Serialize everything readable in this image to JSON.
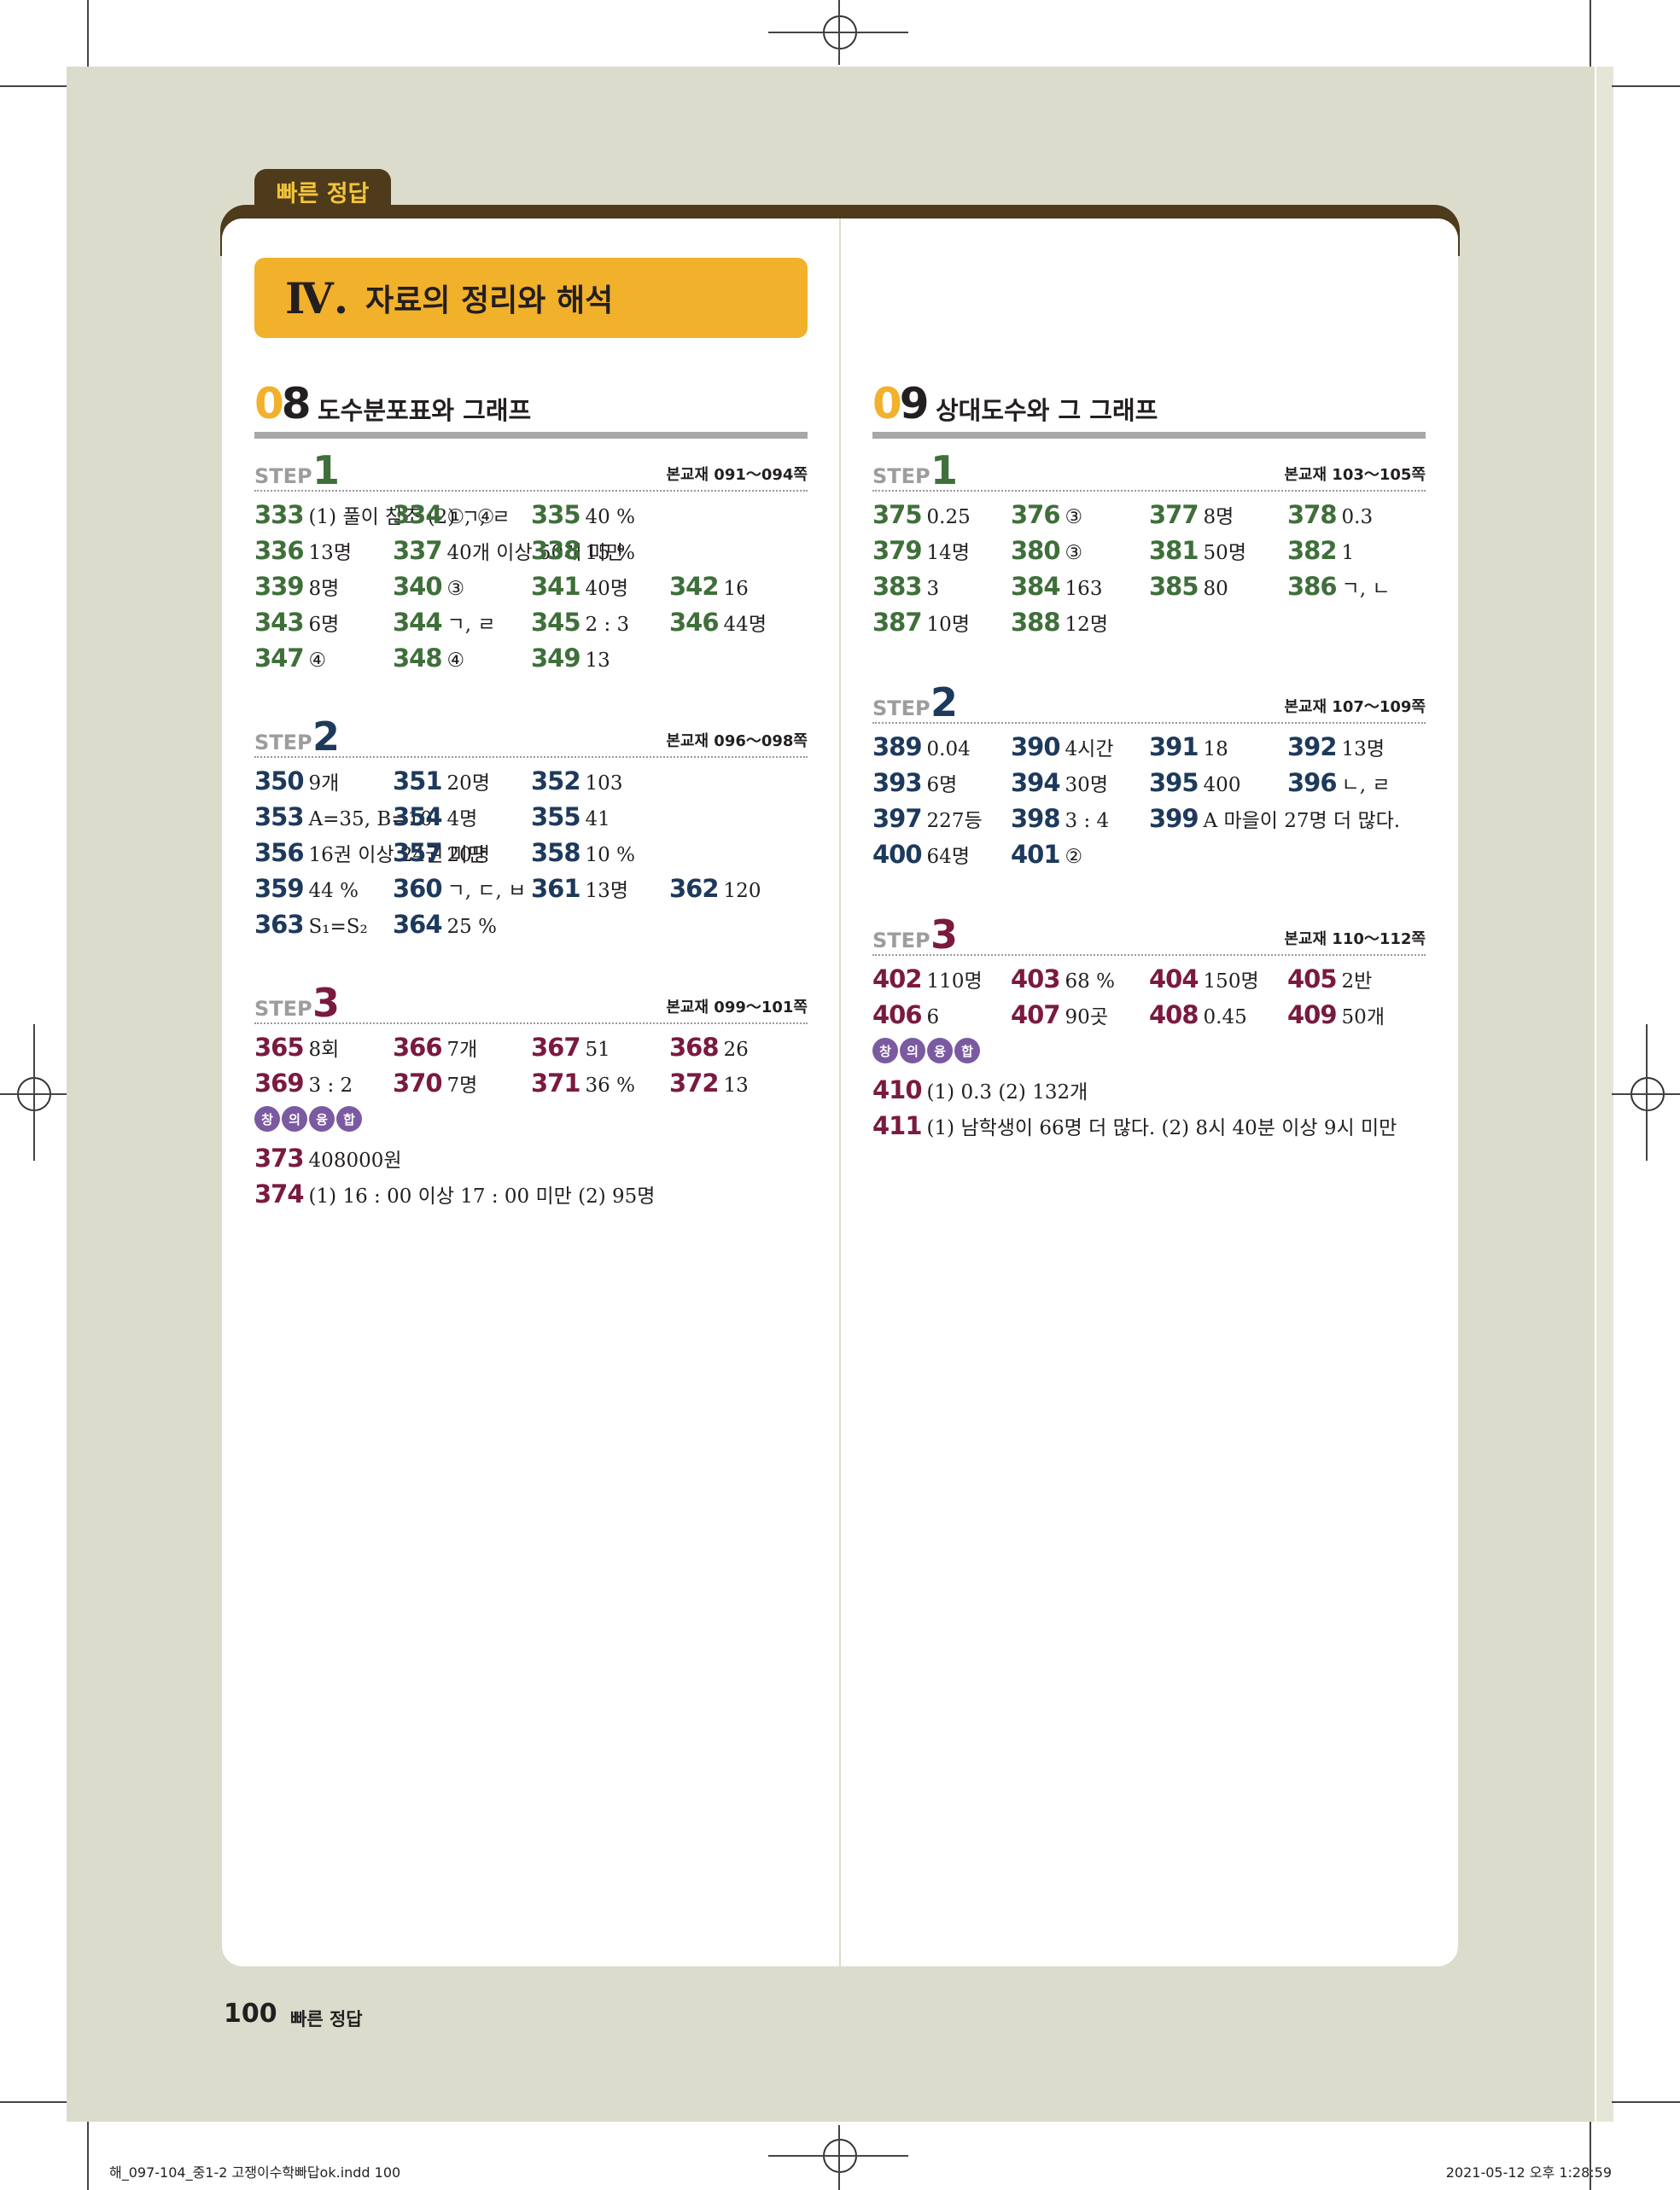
{
  "header_tab": "빠른 정답",
  "unit": {
    "numeral": "Ⅳ.",
    "title": "자료의 정리와 해석"
  },
  "left": {
    "chapter": {
      "num_zero": "0",
      "num": "8",
      "title": "도수분포표와 그래프"
    },
    "steps": [
      {
        "label": "STEP",
        "n": "1",
        "ref": "본교재 091～094쪽",
        "rows": [
          [
            {
              "q": "333",
              "a": "(1) 풀이 참조  (2) ㄱ, ㄹ"
            },
            {
              "q": "334",
              "a": "①, ④"
            },
            {
              "q": "335",
              "a": "40 %"
            }
          ],
          [
            {
              "q": "336",
              "a": "13명"
            },
            {
              "q": "337",
              "a": "40개 이상 50개 미만"
            },
            {
              "q": "338",
              "a": "15 %"
            }
          ],
          [
            {
              "q": "339",
              "a": "8명"
            },
            {
              "q": "340",
              "a": "③"
            },
            {
              "q": "341",
              "a": "40명"
            },
            {
              "q": "342",
              "a": "16"
            }
          ],
          [
            {
              "q": "343",
              "a": "6명"
            },
            {
              "q": "344",
              "a": "ㄱ, ㄹ"
            },
            {
              "q": "345",
              "a": "2 : 3"
            },
            {
              "q": "346",
              "a": "44명"
            }
          ],
          [
            {
              "q": "347",
              "a": "④"
            },
            {
              "q": "348",
              "a": "④"
            },
            {
              "q": "349",
              "a": "13"
            }
          ]
        ]
      },
      {
        "label": "STEP",
        "n": "2",
        "ref": "본교재 096～098쪽",
        "rows": [
          [
            {
              "q": "350",
              "a": "9개"
            },
            {
              "q": "351",
              "a": "20명"
            },
            {
              "q": "352",
              "a": "103"
            }
          ],
          [
            {
              "q": "353",
              "a": "A=35, B=10"
            },
            {
              "q": "354",
              "a": "4명"
            },
            {
              "q": "355",
              "a": "41"
            }
          ],
          [
            {
              "q": "356",
              "a": "16권 이상 24권 미만"
            },
            {
              "q": "357",
              "a": "20명"
            },
            {
              "q": "358",
              "a": "10 %"
            }
          ],
          [
            {
              "q": "359",
              "a": "44 %"
            },
            {
              "q": "360",
              "a": "ㄱ, ㄷ, ㅂ"
            },
            {
              "q": "361",
              "a": "13명"
            },
            {
              "q": "362",
              "a": "120"
            }
          ],
          [
            {
              "q": "363",
              "a": "S₁=S₂"
            },
            {
              "q": "364",
              "a": "25 %"
            }
          ]
        ]
      },
      {
        "label": "STEP",
        "n": "3",
        "ref": "본교재 099～101쪽",
        "rows": [
          [
            {
              "q": "365",
              "a": "8회"
            },
            {
              "q": "366",
              "a": "7개"
            },
            {
              "q": "367",
              "a": "51"
            },
            {
              "q": "368",
              "a": "26"
            }
          ],
          [
            {
              "q": "369",
              "a": "3 : 2"
            },
            {
              "q": "370",
              "a": "7명"
            },
            {
              "q": "371",
              "a": "36 %"
            },
            {
              "q": "372",
              "a": "13"
            }
          ]
        ],
        "badges": [
          "창",
          "의",
          "융",
          "합"
        ],
        "extra": [
          {
            "q": "373",
            "a": "408000원"
          },
          {
            "q": "374",
            "a": "(1) 16 : 00 이상 17 : 00 미만  (2) 95명"
          }
        ]
      }
    ]
  },
  "right": {
    "chapter": {
      "num_zero": "0",
      "num": "9",
      "title": "상대도수와 그 그래프"
    },
    "steps": [
      {
        "label": "STEP",
        "n": "1",
        "ref": "본교재 103～105쪽",
        "rows": [
          [
            {
              "q": "375",
              "a": "0.25"
            },
            {
              "q": "376",
              "a": "③"
            },
            {
              "q": "377",
              "a": "8명"
            },
            {
              "q": "378",
              "a": "0.3"
            }
          ],
          [
            {
              "q": "379",
              "a": "14명"
            },
            {
              "q": "380",
              "a": "③"
            },
            {
              "q": "381",
              "a": "50명"
            },
            {
              "q": "382",
              "a": "1"
            }
          ],
          [
            {
              "q": "383",
              "a": "3"
            },
            {
              "q": "384",
              "a": "163"
            },
            {
              "q": "385",
              "a": "80"
            },
            {
              "q": "386",
              "a": "ㄱ, ㄴ"
            }
          ],
          [
            {
              "q": "387",
              "a": "10명"
            },
            {
              "q": "388",
              "a": "12명"
            }
          ]
        ]
      },
      {
        "label": "STEP",
        "n": "2",
        "ref": "본교재 107～109쪽",
        "rows": [
          [
            {
              "q": "389",
              "a": "0.04"
            },
            {
              "q": "390",
              "a": "4시간"
            },
            {
              "q": "391",
              "a": "18"
            },
            {
              "q": "392",
              "a": "13명"
            }
          ],
          [
            {
              "q": "393",
              "a": "6명"
            },
            {
              "q": "394",
              "a": "30명"
            },
            {
              "q": "395",
              "a": "400"
            },
            {
              "q": "396",
              "a": "ㄴ, ㄹ"
            }
          ],
          [
            {
              "q": "397",
              "a": "227등"
            },
            {
              "q": "398",
              "a": "3 : 4"
            },
            {
              "q": "399",
              "a": "A 마을이 27명 더 많다."
            }
          ],
          [
            {
              "q": "400",
              "a": "64명"
            },
            {
              "q": "401",
              "a": "②"
            }
          ]
        ]
      },
      {
        "label": "STEP",
        "n": "3",
        "ref": "본교재 110～112쪽",
        "rows": [
          [
            {
              "q": "402",
              "a": "110명"
            },
            {
              "q": "403",
              "a": "68 %"
            },
            {
              "q": "404",
              "a": "150명"
            },
            {
              "q": "405",
              "a": "2반"
            }
          ],
          [
            {
              "q": "406",
              "a": "6"
            },
            {
              "q": "407",
              "a": "90곳"
            },
            {
              "q": "408",
              "a": "0.45"
            },
            {
              "q": "409",
              "a": "50개"
            }
          ]
        ],
        "badges": [
          "창",
          "의",
          "융",
          "합"
        ],
        "extra": [
          {
            "q": "410",
            "a": "(1) 0.3  (2) 132개"
          },
          {
            "q": "411",
            "a": "(1) 남학생이 66명 더 많다.  (2) 8시 40분 이상 9시 미만"
          }
        ]
      }
    ]
  },
  "footer": {
    "page": "100",
    "label": "빠른 정답"
  },
  "slug": {
    "file": "해_097-104_중1-2 고쟁이수학빠답ok.indd   100",
    "date": "2021-05-12   오후 1:28:59"
  },
  "colors": {
    "step1": "#3f6f3a",
    "step2": "#1d3a5c",
    "step3": "#7a1a3f",
    "accent": "#f2b12b",
    "tab": "#4e3b1c"
  }
}
